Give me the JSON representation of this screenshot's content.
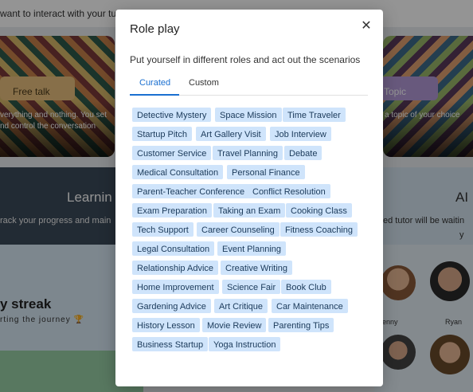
{
  "background": {
    "intro_text": "want to interact with your tuto",
    "free_talk_label": "Free talk",
    "free_talk_desc": "verything and nothing. You set\nnd control the conversation",
    "topic_label": "Topic",
    "topic_desc": "a topic of your choice",
    "learning_title": "Learnin",
    "learning_sub": "rack your progress and main",
    "ai_title": "AI",
    "ai_sub": "ed tutor will be waitin",
    "ai_sub2": "y",
    "streak_title": "y streak",
    "streak_sub": "rting the journey 🏆",
    "tutors": [
      "enny",
      "Ryan"
    ]
  },
  "modal": {
    "title": "Role play",
    "close_glyph": "✕",
    "description": "Put yourself in different roles and act out the scenarios",
    "tabs": [
      "Curated",
      "Custom"
    ],
    "scenarios": [
      "Detective Mystery",
      "Space Mission",
      "Time Traveler",
      "Startup Pitch",
      "Art Gallery Visit",
      "Job Interview",
      "Customer Service",
      "Travel Planning",
      "Debate",
      "Medical Consultation",
      "Personal Finance",
      "Parent-Teacher Conference",
      "Conflict Resolution",
      "Exam Preparation",
      "Taking an Exam",
      "Cooking Class",
      "Tech Support",
      "Career Counseling",
      "Fitness Coaching",
      "Legal Consultation",
      "Event Planning",
      "Relationship Advice",
      "Creative Writing",
      "Home Improvement",
      "Science Fair",
      "Book Club",
      "Gardening Advice",
      "Art Critique",
      "Car Maintenance",
      "History Lesson",
      "Movie Review",
      "Parenting Tips",
      "Business Startup",
      "Yoga Instruction"
    ]
  },
  "colors": {
    "accent": "#1a6fd0",
    "chip_bg": "#cfe4fb",
    "free_talk_bg": "#e8c07e",
    "topic_bg": "#b39ad8"
  }
}
